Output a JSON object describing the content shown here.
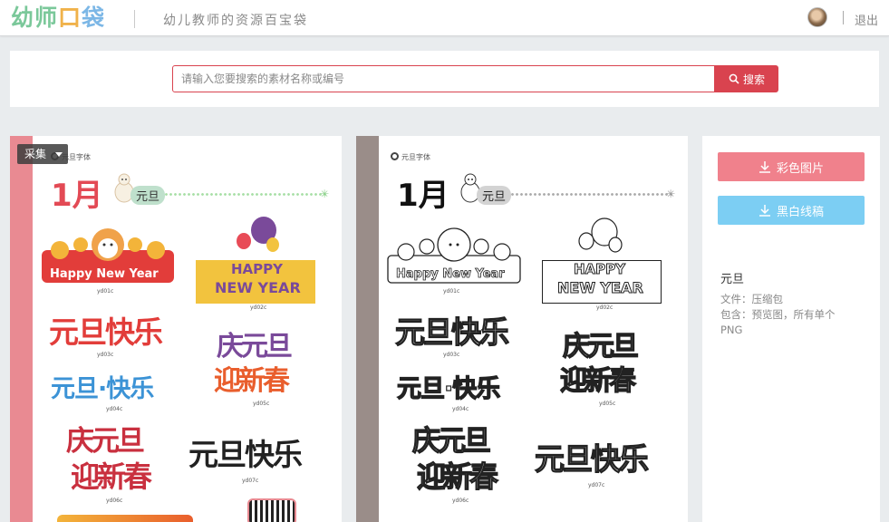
{
  "header": {
    "logo": {
      "part1": "幼师",
      "part2": "口",
      "part3": "袋"
    },
    "tagline": "幼儿教师的资源百宝袋",
    "logout_label": "退出"
  },
  "search": {
    "placeholder": "请输入您要搜索的素材名称或编号",
    "button_label": "搜索"
  },
  "preview_color": {
    "collect_label": "采集",
    "font_title": "元旦字体",
    "month_label": "1月",
    "chip_label": "元旦",
    "stickers": {
      "happy_new_year": "Happy New Year",
      "happy": "HAPPY",
      "new_year": "NEW YEAR",
      "yuandan_kuaile": "元旦快乐",
      "qing": "庆元旦",
      "ying": "迎新春",
      "yuandan_dots": "元旦·快乐",
      "qing2": "庆元旦",
      "ying2": "迎新春",
      "yuandan_kuaile2": "元旦快乐"
    },
    "codes": [
      "yd01c",
      "yd02c",
      "yd03c",
      "yd04c",
      "yd05c",
      "yd06c",
      "yd07c"
    ]
  },
  "preview_line": {
    "font_title": "元旦字体",
    "month_label": "1月",
    "chip_label": "元旦",
    "stickers": {
      "happy_new_year": "Happy New Year",
      "happy": "HAPPY",
      "new_year": "NEW YEAR",
      "yuandan_kuaile": "元旦快乐",
      "qing": "庆元旦",
      "ying": "迎新春",
      "yuandan_dots": "元旦·快乐",
      "qing2": "庆元旦",
      "ying2": "迎新春",
      "yuandan_kuaile2": "元旦快乐"
    },
    "codes": [
      "yd01c",
      "yd02c",
      "yd03c",
      "yd04c",
      "yd05c",
      "yd06c",
      "yd07c"
    ]
  },
  "sidebar": {
    "color_button_label": "彩色图片",
    "line_button_label": "黑白线稿",
    "resource_title": "元旦",
    "file_line": "文件：压缩包",
    "contains_line": "包含：预览图，所有单个PNG"
  },
  "colors": {
    "brand_red": "#d9434f",
    "pink_button": "#f0818c",
    "blue_button": "#7ccef3",
    "color_strip": "#e98a92",
    "line_strip": "#9a8d89"
  },
  "icons": [
    "search-icon",
    "download-icon",
    "chevron-down-icon",
    "avatar"
  ]
}
